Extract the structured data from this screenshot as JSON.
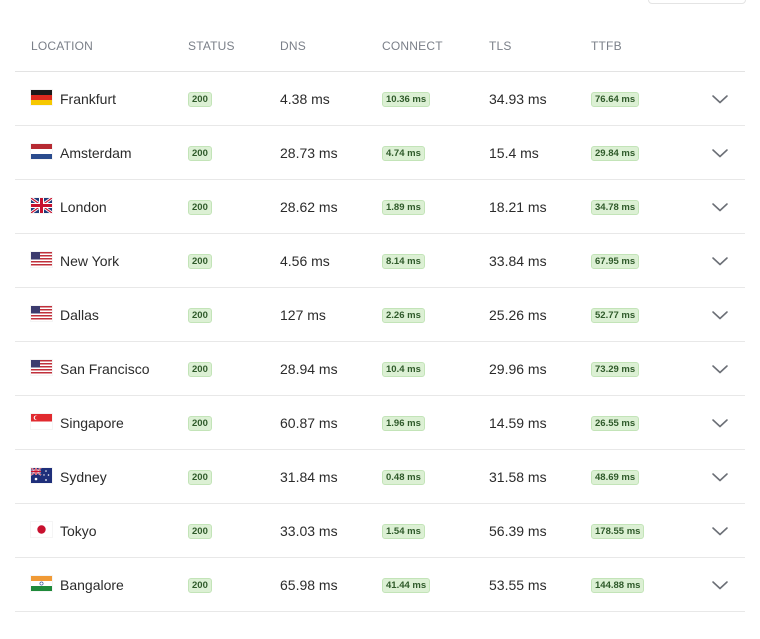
{
  "headers": {
    "location": "LOCATION",
    "status": "STATUS",
    "dns": "DNS",
    "connect": "CONNECT",
    "tls": "TLS",
    "ttfb": "TTFB"
  },
  "colors": {
    "badge_bg": "#dcf0d4",
    "badge_text": "#2f5a2a",
    "header_text": "#7a7f88"
  },
  "rows": [
    {
      "flag": "germany-flag-icon",
      "location": "Frankfurt",
      "status": "200",
      "dns": "4.38 ms",
      "connect": "10.36 ms",
      "tls": "34.93 ms",
      "ttfb": "76.64 ms"
    },
    {
      "flag": "netherlands-flag-icon",
      "location": "Amsterdam",
      "status": "200",
      "dns": "28.73 ms",
      "connect": "4.74 ms",
      "tls": "15.4 ms",
      "ttfb": "29.84 ms"
    },
    {
      "flag": "uk-flag-icon",
      "location": "London",
      "status": "200",
      "dns": "28.62 ms",
      "connect": "1.89 ms",
      "tls": "18.21 ms",
      "ttfb": "34.78 ms"
    },
    {
      "flag": "us-flag-icon",
      "location": "New York",
      "status": "200",
      "dns": "4.56 ms",
      "connect": "8.14 ms",
      "tls": "33.84 ms",
      "ttfb": "67.95 ms"
    },
    {
      "flag": "us-flag-icon",
      "location": "Dallas",
      "status": "200",
      "dns": "127 ms",
      "connect": "2.26 ms",
      "tls": "25.26 ms",
      "ttfb": "52.77 ms"
    },
    {
      "flag": "us-flag-icon",
      "location": "San Francisco",
      "status": "200",
      "dns": "28.94 ms",
      "connect": "10.4 ms",
      "tls": "29.96 ms",
      "ttfb": "73.29 ms"
    },
    {
      "flag": "singapore-flag-icon",
      "location": "Singapore",
      "status": "200",
      "dns": "60.87 ms",
      "connect": "1.96 ms",
      "tls": "14.59 ms",
      "ttfb": "26.55 ms"
    },
    {
      "flag": "australia-flag-icon",
      "location": "Sydney",
      "status": "200",
      "dns": "31.84 ms",
      "connect": "0.48 ms",
      "tls": "31.58 ms",
      "ttfb": "48.69 ms"
    },
    {
      "flag": "japan-flag-icon",
      "location": "Tokyo",
      "status": "200",
      "dns": "33.03 ms",
      "connect": "1.54 ms",
      "tls": "56.39 ms",
      "ttfb": "178.55 ms"
    },
    {
      "flag": "india-flag-icon",
      "location": "Bangalore",
      "status": "200",
      "dns": "65.98 ms",
      "connect": "41.44 ms",
      "tls": "53.55 ms",
      "ttfb": "144.88 ms"
    }
  ]
}
